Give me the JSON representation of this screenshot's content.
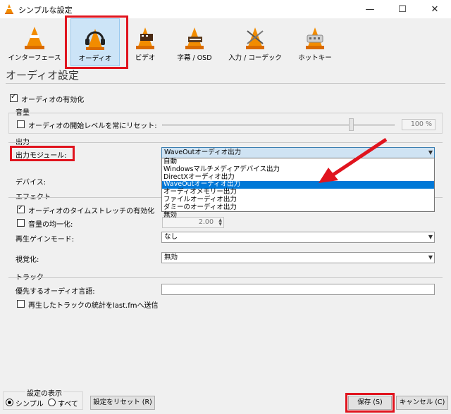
{
  "window": {
    "title": "シンプルな設定"
  },
  "toolbar": {
    "items": [
      {
        "label": "インターフェース"
      },
      {
        "label": "オーディオ"
      },
      {
        "label": "ビデオ"
      },
      {
        "label": "字幕 / OSD"
      },
      {
        "label": "入力 / コーデック"
      },
      {
        "label": "ホットキー"
      }
    ]
  },
  "page": {
    "title": "オーディオ設定"
  },
  "audio": {
    "enable_label": "オーディオの有効化",
    "volume": {
      "group_title": "音量",
      "reset_label": "オーディオの開始レベルを常にリセット:",
      "percent": "100 %"
    },
    "output": {
      "group_title": "出力",
      "module_label": "出力モジュール:",
      "module_value": "WaveOutオーディオ出力",
      "device_label": "デバイス:",
      "options": [
        "自動",
        "Windowsマルチメディアデバイス出力",
        "DirectXオーディオ出力",
        "WaveOutオーディオ出力",
        "オーディオメモリー出力",
        "ファイルオーディオ出力",
        "ダミーのオーディオ出力",
        "無効"
      ]
    },
    "effects": {
      "group_title": "エフェクト",
      "timestretch_label": "オーディオのタイムストレッチの有効化",
      "normalize_label": "音量の均一化:",
      "normalize_value": "2.00",
      "replaygain_label": "再生ゲインモード:",
      "replaygain_value": "なし",
      "visualization_label": "視覚化:",
      "visualization_value": "無効"
    },
    "tracks": {
      "group_title": "トラック",
      "preferred_lang_label": "優先するオーディオ言語:",
      "lastfm_label": "再生したトラックの統計をlast.fmへ送信"
    }
  },
  "footer": {
    "show_settings_title": "設定の表示",
    "simple_label": "シンプル",
    "all_label": "すべて",
    "reset_button": "設定をリセット (R)",
    "save_button": "保存 (S)",
    "cancel_button": "キャンセル (C)"
  },
  "colors": {
    "highlight_red": "#e0141e",
    "selection_blue": "#0078d7",
    "vlc_orange": "#f28c00"
  },
  "icons": [
    "vlc-cone-icon",
    "headphones-icon",
    "film-icon",
    "subtitle-icon",
    "codec-icon",
    "hotkey-icon",
    "minimize-icon",
    "maximize-icon",
    "close-icon",
    "red-arrow-annotation"
  ]
}
